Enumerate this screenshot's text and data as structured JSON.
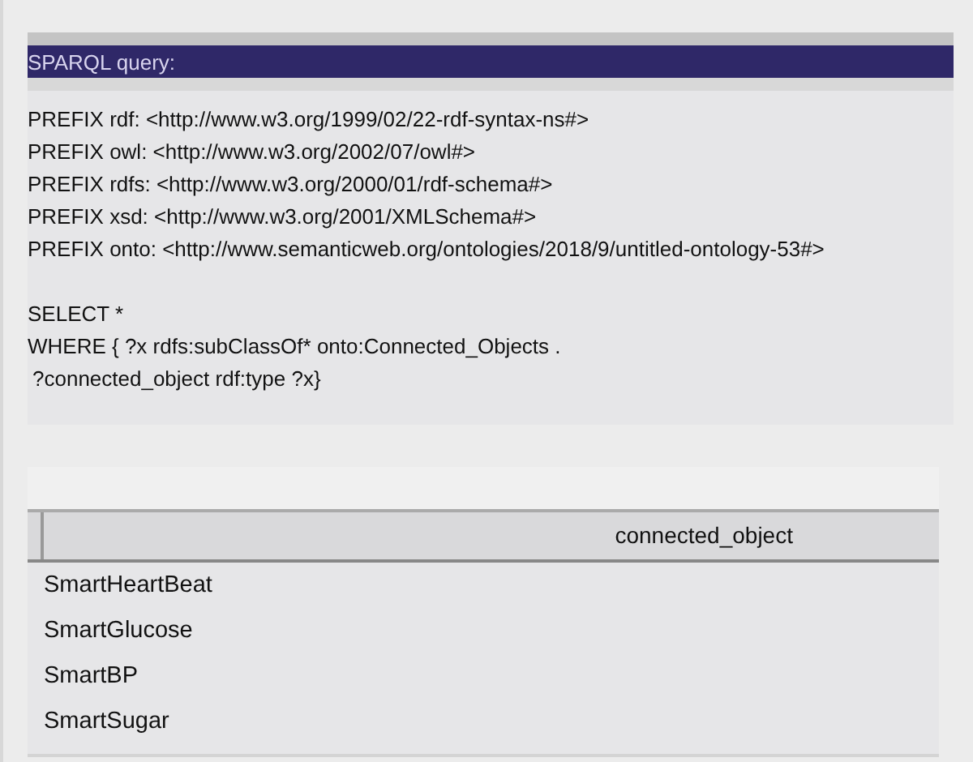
{
  "query_panel": {
    "title": "SPARQL query:",
    "prefixes": [
      "PREFIX rdf: <http://www.w3.org/1999/02/22-rdf-syntax-ns#>",
      "PREFIX owl: <http://www.w3.org/2002/07/owl#>",
      "PREFIX rdfs: <http://www.w3.org/2000/01/rdf-schema#>",
      "PREFIX xsd: <http://www.w3.org/2001/XMLSchema#>",
      "PREFIX onto: <http://www.semanticweb.org/ontologies/2018/9/untitled-ontology-53#>"
    ],
    "query_lines": [
      "SELECT *",
      "WHERE { ?x rdfs:subClassOf* onto:Connected_Objects .",
      "?connected_object rdf:type ?x}"
    ]
  },
  "results_table": {
    "columns": [
      "connected_object"
    ],
    "rows": [
      "SmartHeartBeat",
      "SmartGlucose",
      "SmartBP",
      "SmartSugar"
    ]
  }
}
